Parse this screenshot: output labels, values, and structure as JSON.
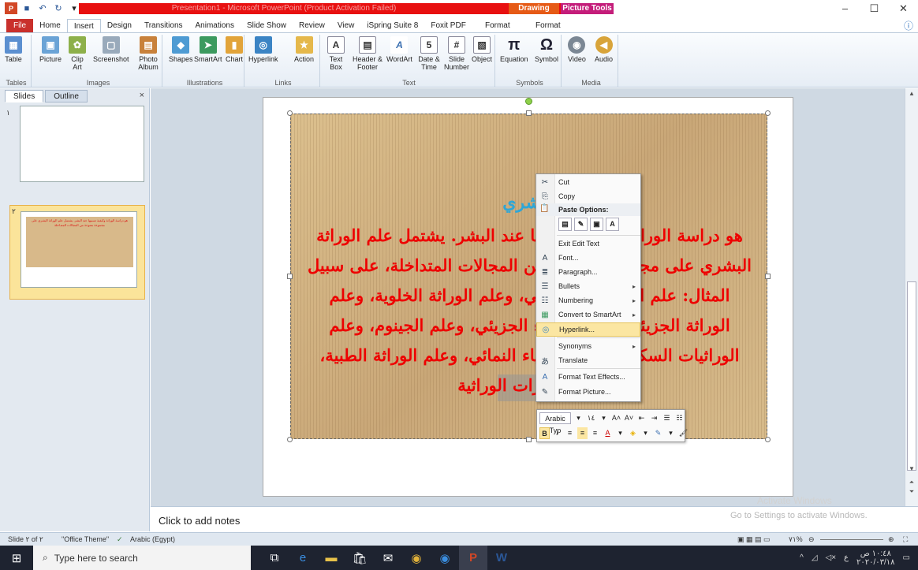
{
  "window": {
    "title": "Presentation1 - Microsoft PowerPoint (Product Activation Failed)",
    "context_groups": [
      "Drawing Tools",
      "Picture Tools"
    ]
  },
  "ribbon_tabs": [
    "File",
    "Home",
    "Insert",
    "Design",
    "Transitions",
    "Animations",
    "Slide Show",
    "Review",
    "View",
    "iSpring Suite 8",
    "Foxit PDF",
    "Format",
    "Format"
  ],
  "ribbon_groups": {
    "tables": {
      "label": "Tables",
      "buttons": [
        "Table"
      ]
    },
    "images": {
      "label": "Images",
      "buttons": [
        "Picture",
        "Clip Art",
        "Screenshot",
        "Photo Album"
      ]
    },
    "illustrations": {
      "label": "Illustrations",
      "buttons": [
        "Shapes",
        "SmartArt",
        "Chart"
      ]
    },
    "links": {
      "label": "Links",
      "buttons": [
        "Hyperlink",
        "Action"
      ]
    },
    "text": {
      "label": "Text",
      "buttons": [
        "Text Box",
        "Header & Footer",
        "WordArt",
        "Date & Time",
        "Slide Number",
        "Object"
      ]
    },
    "symbols": {
      "label": "Symbols",
      "buttons": [
        "Equation",
        "Symbol"
      ]
    },
    "media": {
      "label": "Media",
      "buttons": [
        "Video",
        "Audio"
      ]
    }
  },
  "slides_panel": {
    "tabs": [
      "Slides",
      "Outline"
    ],
    "close": "×",
    "slide_numbers": [
      "١",
      "٢"
    ],
    "thumb_text": "هو دراسة الوراثة وكيفية تسببها عند البشر. يشتمل علم الوراثة البشري على مجموعة متنوعة من المجالات المتداخلة"
  },
  "slide": {
    "heading": "البشري",
    "body": "هو دراسة الوراثة وكيفية تسببها عند البشر. يشتمل علم الوراثة البشري على مجموعة متنوعة من المجالات المتداخلة، على سبيل المثال: علم الوراثة الكلاسيكي، وعلم الوراثة الخلوية، وعلم الوراثة الجزيئي، وعلم الأحياء الجزيئي، وعلم الجينوم، وعلم الوراثيات السكانية، وعلم الأحياء النمائي، وعلم الوراثة الطبية، والاستشارات الوراثية"
  },
  "context_menu": {
    "cut": "Cut",
    "copy": "Copy",
    "paste_options": "Paste Options:",
    "exit_edit_text": "Exit Edit Text",
    "font": "Font...",
    "paragraph": "Paragraph...",
    "bullets": "Bullets",
    "numbering": "Numbering",
    "convert_smartart": "Convert to SmartArt",
    "hyperlink": "Hyperlink...",
    "synonyms": "Synonyms",
    "translate": "Translate",
    "format_text_effects": "Format Text Effects...",
    "format_picture": "Format Picture..."
  },
  "mini_toolbar": {
    "font": "Arabic Typ",
    "size": "١٤",
    "grow": "A˄",
    "shrink": "A˅"
  },
  "notes": {
    "placeholder": "Click to add notes"
  },
  "watermark": {
    "line1": "Activate Windows",
    "line2": "Go to Settings to activate Windows."
  },
  "status_bar": {
    "slide": "Slide ٢ of ٢",
    "theme": "\"Office Theme\"",
    "language": "Arabic (Egypt)",
    "zoom": "٧١%"
  },
  "taskbar": {
    "search_placeholder": "Type here to search",
    "time": "١٠:٤٨ ص",
    "date": "٢٠٢٠/٠٣/١٨"
  },
  "colors": {
    "accent_red": "#e81010",
    "drawing_tools": "#e65a16",
    "picture_tools": "#c41d7a",
    "slide_text": "#e00000",
    "slide_heading": "#2fa6d6"
  }
}
